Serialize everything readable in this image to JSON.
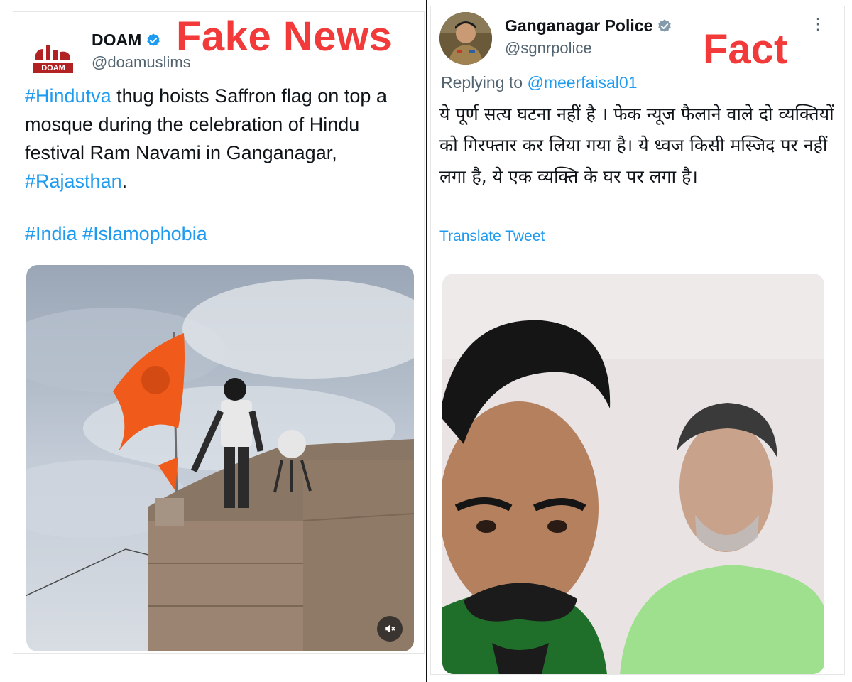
{
  "labels": {
    "fake": "Fake News",
    "fact": "Fact"
  },
  "left_tweet": {
    "avatar_text": "DOAM",
    "name": "DOAM",
    "handle": "@doamuslims",
    "text_parts": [
      {
        "text": "#Hindutva",
        "tag": true
      },
      {
        "text": " thug hoists Saffron flag on top a mosque during the celebration of Hindu festival Ram Navami in Ganganagar, ",
        "tag": false
      },
      {
        "text": "#Rajasthan",
        "tag": true
      },
      {
        "text": ".",
        "tag": false
      }
    ],
    "hashtags": [
      "#India",
      "#Islamophobia"
    ],
    "mute_icon": "speaker-mute-icon"
  },
  "right_tweet": {
    "name": "Ganganagar Police",
    "handle": "@sgnrpolice",
    "reply_prefix": "Replying to",
    "reply_handle": "@meerfaisal01",
    "text": "ये पूर्ण सत्य घटना नहीं है । फेक न्यूज फैलाने वाले दो व्यक्तियों को गिरफ्तार कर लिया गया है। ये ध्वज किसी मस्जिद पर नहीं लगा है, ये एक व्यक्ति के घर पर लगा है।",
    "translate": "Translate Tweet",
    "more_icon": "more-options-icon"
  },
  "colors": {
    "verdict_red": "#f23a3a",
    "link_blue": "#1d9bf0",
    "verified_blue": "#1d9bf0",
    "handle_gray": "#536471"
  }
}
